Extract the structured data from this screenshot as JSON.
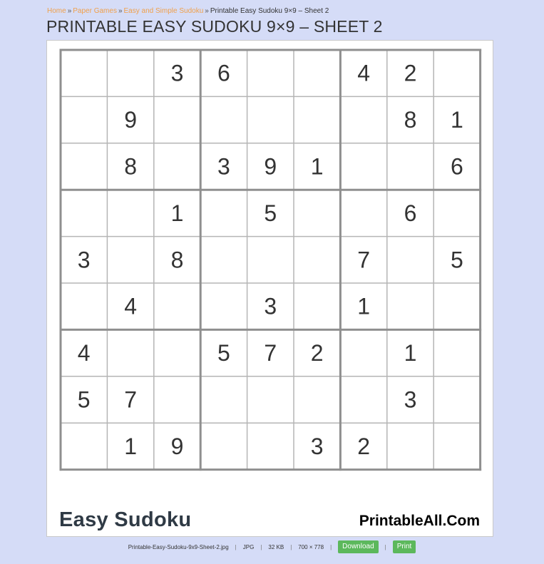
{
  "breadcrumb": {
    "items": [
      "Home",
      "Paper Games",
      "Easy and Simple Sudoku"
    ],
    "separator": "»",
    "current": "Printable Easy Sudoku 9×9 – Sheet 2"
  },
  "page_title": "PRINTABLE EASY SUDOKU 9×9 – SHEET 2",
  "sudoku": {
    "grid": [
      [
        "",
        "",
        "3",
        "6",
        "",
        "",
        "4",
        "2",
        ""
      ],
      [
        "",
        "9",
        "",
        "",
        "",
        "",
        "",
        "8",
        "1"
      ],
      [
        "",
        "8",
        "",
        "3",
        "9",
        "1",
        "",
        "",
        "6"
      ],
      [
        "",
        "",
        "1",
        "",
        "5",
        "",
        "",
        "6",
        ""
      ],
      [
        "3",
        "",
        "8",
        "",
        "",
        "",
        "7",
        "",
        "5"
      ],
      [
        "",
        "4",
        "",
        "",
        "3",
        "",
        "1",
        "",
        ""
      ],
      [
        "4",
        "",
        "",
        "5",
        "7",
        "2",
        "",
        "1",
        ""
      ],
      [
        "5",
        "7",
        "",
        "",
        "",
        "",
        "",
        "3",
        ""
      ],
      [
        "",
        "1",
        "9",
        "",
        "",
        "3",
        "2",
        "",
        ""
      ]
    ],
    "footer_left": "Easy Sudoku",
    "footer_right": "PrintableAll.Com"
  },
  "file_info": {
    "filename": "Printable-Easy-Sudoku-9x9-Sheet-2.jpg",
    "format": "JPG",
    "size": "32 KB",
    "dimensions": "700 × 778",
    "separator": "|",
    "download_label": "Download",
    "print_label": "Print"
  },
  "colors": {
    "background": "#d5dcf7",
    "breadcrumb_link": "#f0a04b",
    "button": "#5cb85c"
  }
}
